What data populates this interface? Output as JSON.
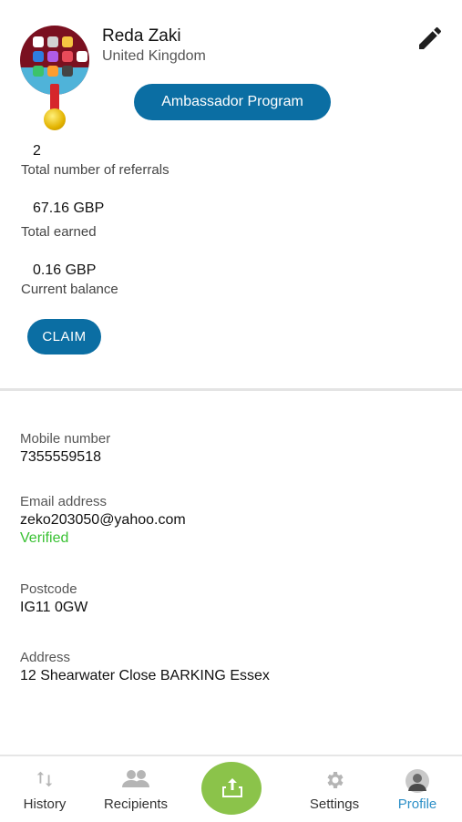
{
  "colors": {
    "accent": "#0b6ea3",
    "verified": "#38c132",
    "fab": "#8bc34a",
    "active_tab": "#2c8fc7"
  },
  "profile": {
    "name": "Reda Zaki",
    "country": "United Kingdom",
    "ambassador_label": "Ambassador Program"
  },
  "stats": {
    "referrals_value": "2",
    "referrals_label": "Total number of referrals",
    "earned_value": "67.16 GBP",
    "earned_label": "Total earned",
    "balance_value": "0.16 GBP",
    "balance_label": "Current balance",
    "claim_label": "CLAIM"
  },
  "details": {
    "mobile_label": "Mobile number",
    "mobile_value": "7355559518",
    "email_label": "Email address",
    "email_value": "zeko203050@yahoo.com",
    "email_status": "Verified",
    "postcode_label": "Postcode",
    "postcode_value": "IG11 0GW",
    "address_label": "Address",
    "address_value": "12 Shearwater Close BARKING Essex"
  },
  "tabs": [
    {
      "label": "History",
      "icon": "sort-arrows-icon"
    },
    {
      "label": "Recipients",
      "icon": "people-icon"
    },
    {
      "label": "",
      "icon": "send-upload-icon"
    },
    {
      "label": "Settings",
      "icon": "gear-icon"
    },
    {
      "label": "Profile",
      "icon": "avatar-icon",
      "active": true
    }
  ]
}
